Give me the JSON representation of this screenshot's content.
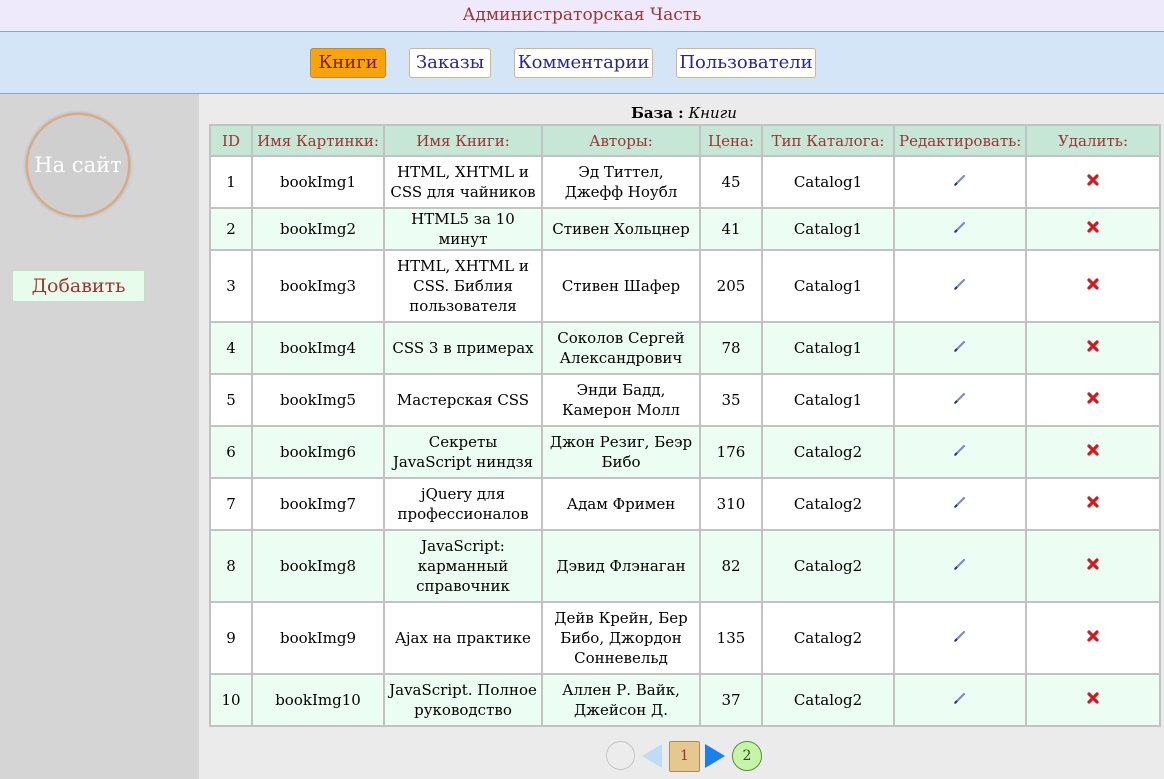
{
  "header": {
    "title": "Администраторская Часть"
  },
  "nav": {
    "tabs": [
      {
        "label": "Книги",
        "active": true
      },
      {
        "label": "Заказы",
        "active": false
      },
      {
        "label": "Комментарии",
        "active": false
      },
      {
        "label": "Пользователи",
        "active": false
      }
    ]
  },
  "sidebar": {
    "to_site_label": "На сайт",
    "add_label": "Добавить"
  },
  "caption": {
    "label": "База :",
    "value": "Книги"
  },
  "table": {
    "columns": [
      "ID",
      "Имя Картинки:",
      "Имя Книги:",
      "Авторы:",
      "Цена:",
      "Тип Каталога:",
      "Редактировать:",
      "Удалить:"
    ],
    "rows": [
      {
        "id": "1",
        "image": "bookImg1",
        "title": "HTML, XHTML и CSS для чайников",
        "authors": "Эд Титтел, Джефф Ноубл",
        "price": "45",
        "catalog": "Catalog1"
      },
      {
        "id": "2",
        "image": "bookImg2",
        "title": "HTML5 за 10 минут",
        "authors": "Стивен Хольцнер",
        "price": "41",
        "catalog": "Catalog1"
      },
      {
        "id": "3",
        "image": "bookImg3",
        "title": "HTML, XHTML и CSS. Библия пользователя",
        "authors": "Стивен Шафер",
        "price": "205",
        "catalog": "Catalog1"
      },
      {
        "id": "4",
        "image": "bookImg4",
        "title": "CSS 3 в примерах",
        "authors": "Соколов Сергей Александрович",
        "price": "78",
        "catalog": "Catalog1"
      },
      {
        "id": "5",
        "image": "bookImg5",
        "title": "Мастерская CSS",
        "authors": "Энди Бадд, Камерон Молл",
        "price": "35",
        "catalog": "Catalog1"
      },
      {
        "id": "6",
        "image": "bookImg6",
        "title": "Секреты JavaScript ниндзя",
        "authors": "Джон Резиг, Беэр Бибо",
        "price": "176",
        "catalog": "Catalog2"
      },
      {
        "id": "7",
        "image": "bookImg7",
        "title": "jQuery для профессионалов",
        "authors": "Адам Фримен",
        "price": "310",
        "catalog": "Catalog2"
      },
      {
        "id": "8",
        "image": "bookImg8",
        "title": "JavaScript: карманный справочник",
        "authors": "Дэвид Флэнаган",
        "price": "82",
        "catalog": "Catalog2"
      },
      {
        "id": "9",
        "image": "bookImg9",
        "title": "Ajax на практике",
        "authors": "Дейв Крейн, Бер Бибо, Джордон Сонневельд",
        "price": "135",
        "catalog": "Catalog2"
      },
      {
        "id": "10",
        "image": "bookImg10",
        "title": "JavaScript. Полное руководство",
        "authors": "Аллен Р. Вайк, Джейсон Д.",
        "price": "37",
        "catalog": "Catalog2"
      }
    ]
  },
  "pager": {
    "current_page": "1",
    "next_page": "2"
  },
  "icons": {
    "edit": "pencil-icon",
    "delete": "red-cross-icon"
  },
  "colors": {
    "accent_tab": "#f7a30b",
    "text_red": "#9b3433",
    "header_bg": "#c6e7d5"
  }
}
